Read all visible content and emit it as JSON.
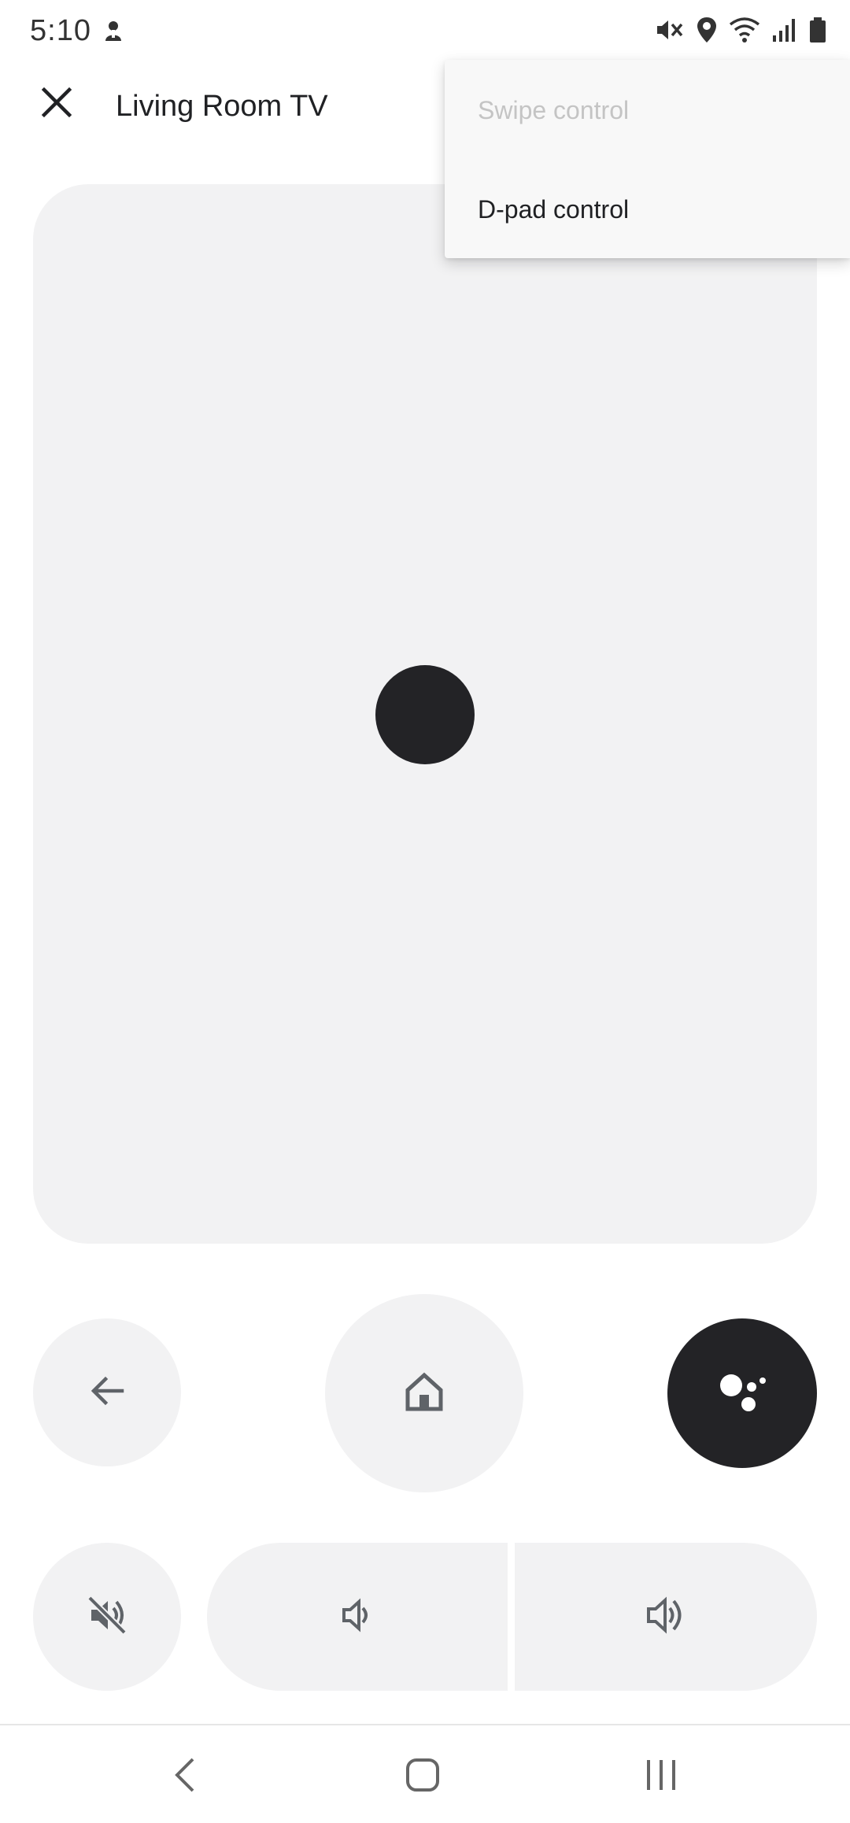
{
  "status_bar": {
    "time": "5:10",
    "icons": [
      "notification-icon",
      "vibrate-mute-icon",
      "location-icon",
      "wifi-icon",
      "signal-icon",
      "battery-icon"
    ]
  },
  "app_bar": {
    "close_icon": "close-icon",
    "title": "Living Room TV"
  },
  "menu": {
    "items": [
      {
        "label": "Swipe control",
        "enabled": false
      },
      {
        "label": "D-pad control",
        "enabled": true
      }
    ]
  },
  "touchpad": {
    "indicator": "touch-indicator"
  },
  "controls": {
    "back_icon": "arrow-back-icon",
    "home_icon": "home-icon",
    "assistant_icon": "google-assistant-icon",
    "mute_icon": "volume-off-icon",
    "volume_down_icon": "volume-down-icon",
    "volume_up_icon": "volume-up-icon"
  },
  "nav_bar": {
    "icons": [
      "nav-back-icon",
      "nav-home-icon",
      "nav-recents-icon"
    ]
  },
  "colors": {
    "surface": "#f2f2f3",
    "dark": "#232326",
    "icon": "#5f6368",
    "disabled_text": "#c4c4c4"
  }
}
